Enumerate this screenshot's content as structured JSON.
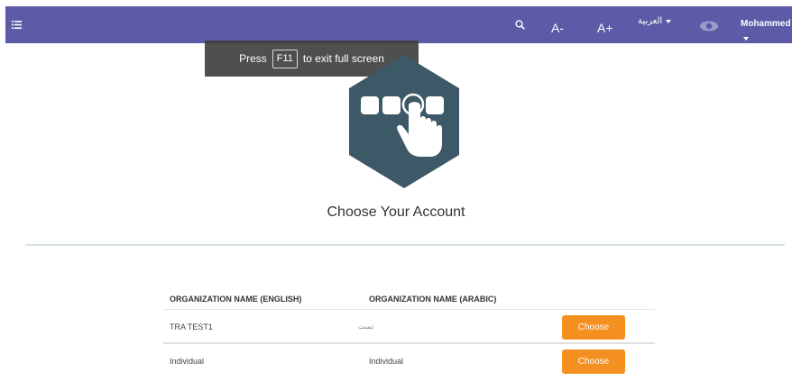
{
  "topbar": {
    "menu_icon": "list-icon",
    "search_icon": "search-icon",
    "font_decrease_label": "A-",
    "font_increase_label": "A+",
    "language_label": "العربية",
    "eye_icon": "eye-icon",
    "user_name": "Mohammed",
    "bar_color": "#5d5ba7"
  },
  "fullscreen_toast": {
    "press": "Press",
    "key": "F11",
    "message": "to exit full screen"
  },
  "logo": {
    "icon": "hand-tapping-keys-hexagon-icon",
    "color": "#3d5866"
  },
  "heading": "Choose Your Account",
  "table": {
    "headers": [
      "ORGANIZATION NAME (ENGLISH)",
      "ORGANIZATION NAME (ARABIC)"
    ],
    "rows": [
      {
        "english": "TRA TEST1",
        "arabic": "تست",
        "action": "Choose"
      },
      {
        "english": "Individual",
        "arabic": "Individual",
        "action": "Choose"
      }
    ]
  },
  "accent_color": "#f3901f"
}
